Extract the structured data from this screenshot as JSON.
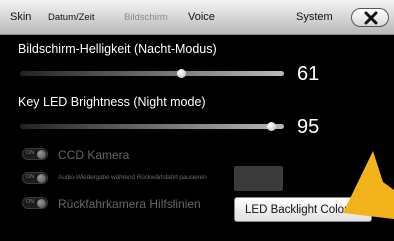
{
  "tabs": {
    "skin": "Skin",
    "datum_zeit": "Datum/Zeit",
    "bildschirm": "Bildschirm",
    "voice": "Voice",
    "system": "System"
  },
  "settings": {
    "brightness_night": {
      "label": "Bildschirm-Helligkeit (Nacht-Modus)",
      "value": "61",
      "level": 0.61
    },
    "key_led": {
      "label": "Key LED Brightness (Night mode)",
      "value": "95",
      "level": 0.95
    }
  },
  "options": [
    {
      "toggle_text": "ON",
      "label": "CCD Kamera"
    },
    {
      "toggle_text": "ON",
      "label": "Audio-Wiedergabe während Rückwärtsfahrt pausieren"
    },
    {
      "toggle_text": "ON",
      "label": "Rückfahrkamera Hilfslinien"
    }
  ],
  "buttons": {
    "led_backlight_color": "LED Backlight Color"
  },
  "colors": {
    "background": "#000000",
    "tabbar": "#d4d4d4",
    "active_tab_text": "#8a8a8a",
    "arrow": "#f2b41a",
    "disabled_text": "#666666"
  }
}
